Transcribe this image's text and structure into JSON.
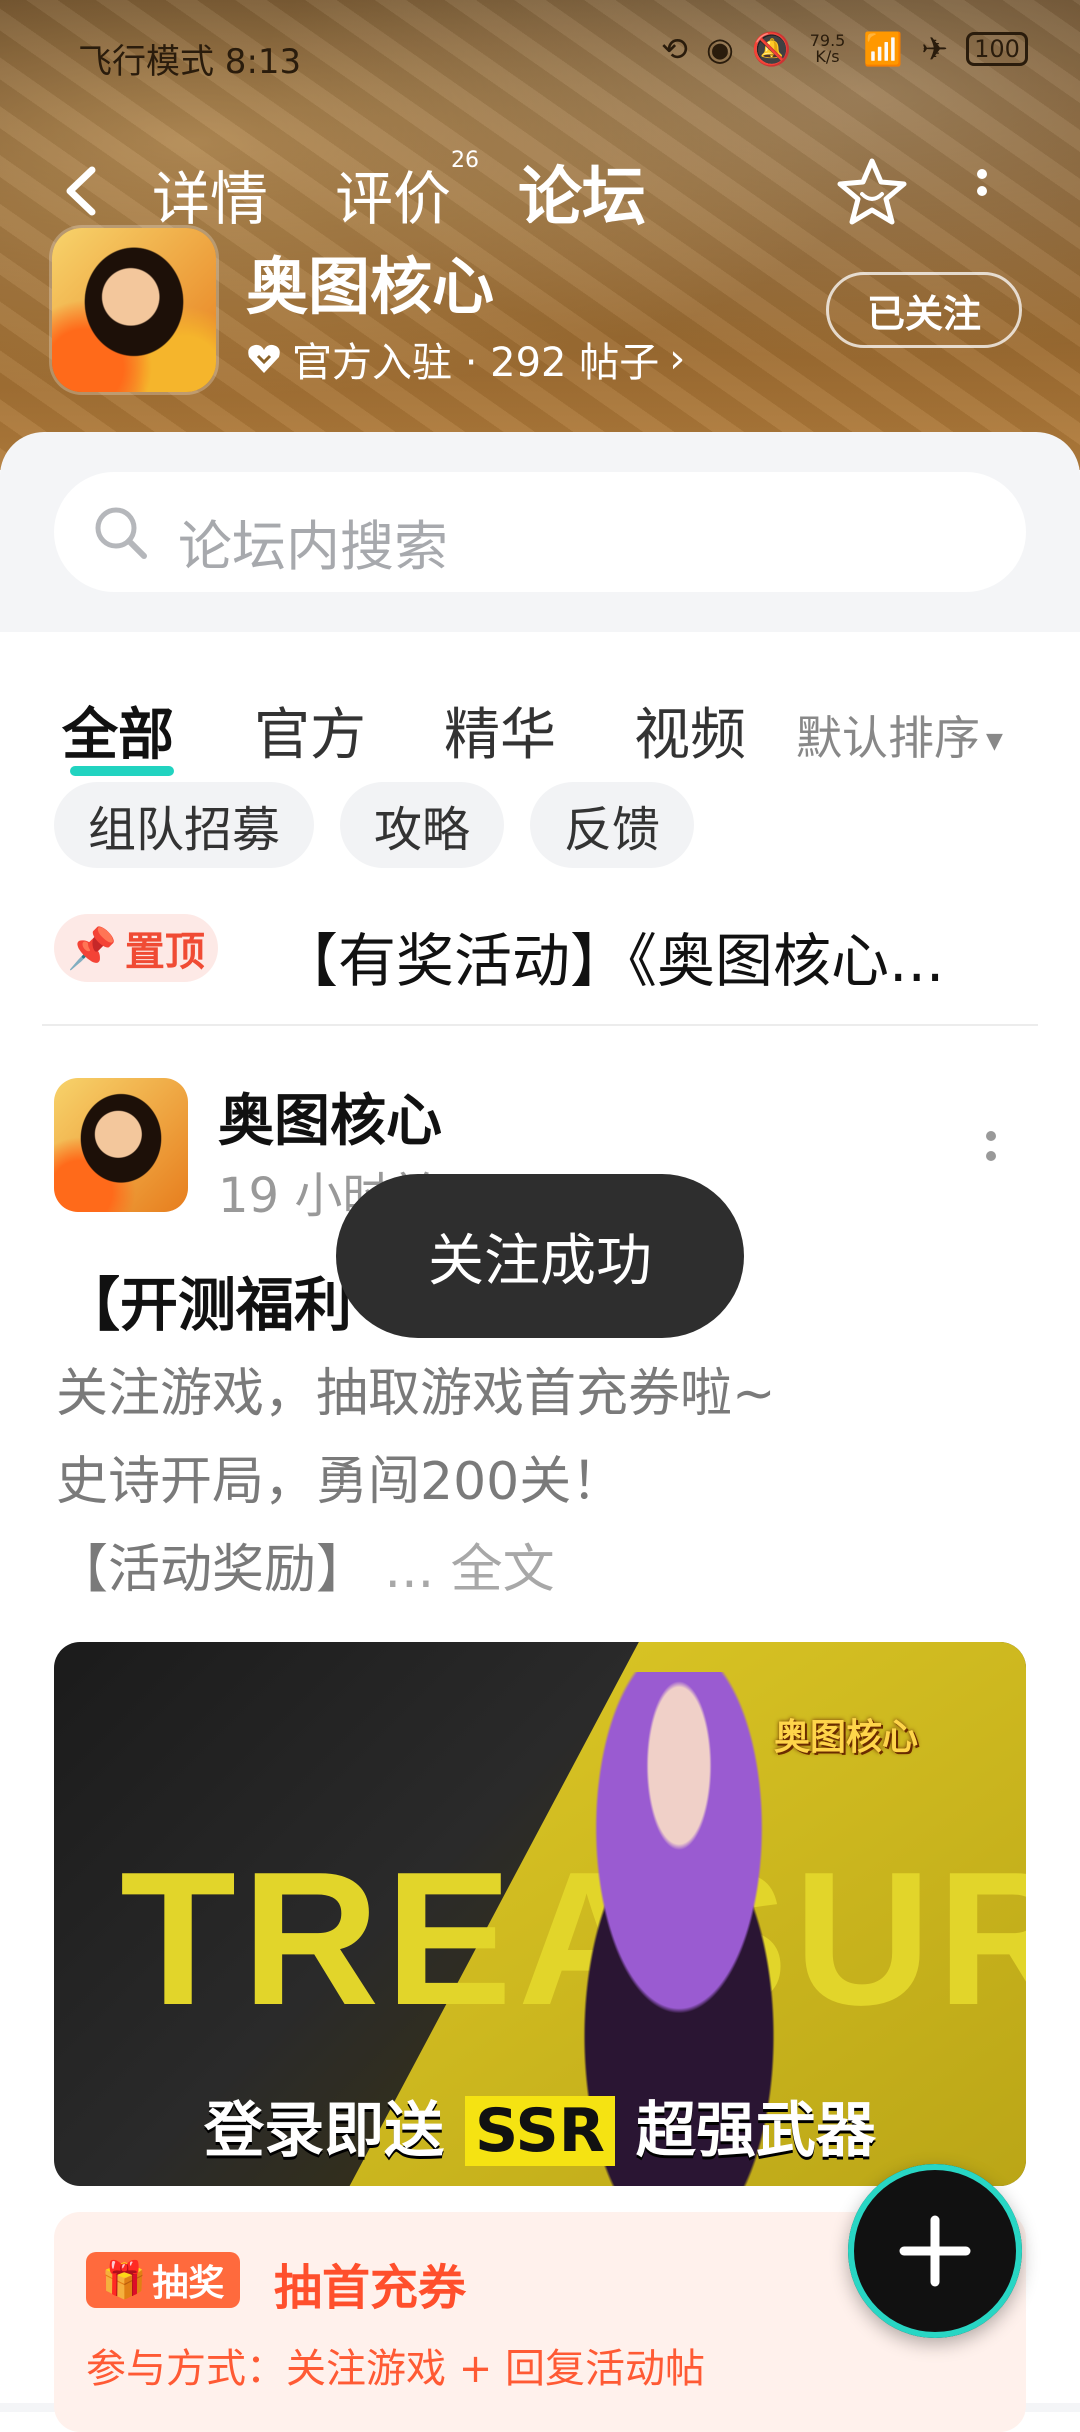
{
  "status_bar": {
    "time": "飞行模式 8:13",
    "net_speed": "79.5\nK/s",
    "battery": "100"
  },
  "nav": {
    "tabs": [
      {
        "label": "详情"
      },
      {
        "label": "评价",
        "count": "26"
      },
      {
        "label": "论坛",
        "active": true
      }
    ]
  },
  "app": {
    "name": "奥图核心",
    "meta": "官方入驻 · 292 帖子",
    "follow_label": "已关注"
  },
  "search": {
    "placeholder": "论坛内搜索"
  },
  "category_tabs": [
    "全部",
    "官方",
    "精华",
    "视频"
  ],
  "sort_label": "默认排序",
  "chips": [
    "组队招募",
    "攻略",
    "反馈"
  ],
  "pinned": {
    "badge": "置顶",
    "title": "【有奖活动】《奥图核心..."
  },
  "post": {
    "author": "奥图核心",
    "time": "19 小时前",
    "title": "【开测福利",
    "body_lines": [
      "关注游戏，抽取游戏首充券啦~",
      "史诗开局，勇闯200关！",
      "【活动奖励】"
    ],
    "more_text": "... 全文",
    "banner": {
      "word": "TREASURE",
      "badge": "奥图核心",
      "slogan_before": "登录即送",
      "slogan_highlight": "SSR",
      "slogan_after": "超强武器"
    }
  },
  "lottery": {
    "badge": "抽奖",
    "title": "抽首充券",
    "way": "参与方式：关注游戏 + 回复活动帖"
  },
  "toast": "关注成功",
  "colors": {
    "accent": "#21d3c0",
    "pin_red": "#f04b34",
    "lottery_orange": "#ff6a3d"
  }
}
